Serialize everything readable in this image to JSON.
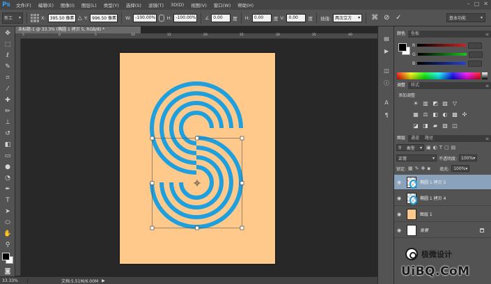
{
  "app": {
    "logo": "Ps"
  },
  "menu": [
    "文件(F)",
    "编辑(E)",
    "图像(I)",
    "图层(L)",
    "类型(Y)",
    "选择(S)",
    "滤镜(T)",
    "3D(D)",
    "视图(V)",
    "窗口(W)",
    "帮助(H)"
  ],
  "window_controls": {
    "minimize": "–",
    "maximize": "□",
    "close": "✕"
  },
  "options": {
    "tool_preset": "新工",
    "x_label": "X:",
    "x_value": "395.50 像素",
    "y_label": "Y:",
    "y_value": "996.50 像素",
    "w_label": "W:",
    "w_value": "-100.00%",
    "h_label": "H:",
    "h_value": "-100.00%",
    "angle_value": "0.00",
    "degree_unit": "度",
    "hskew_label": "H:",
    "hskew_value": "0.00",
    "vskew_label": "V:",
    "vskew_value": "0.00",
    "interp_label": "插值:",
    "interp_value": "两次立方",
    "workspace": "基本功能"
  },
  "document": {
    "tab_title": "未标题-1 @ 33.3% (椭圆 1 拷贝 5, RGB/8) *",
    "canvas_color": "#fec98a",
    "ring_color": "#1ea0de",
    "ruler_ticks": [
      "5",
      "0",
      "5",
      "10",
      "15",
      "20",
      "25",
      "30",
      "35",
      "40"
    ]
  },
  "status": {
    "zoom": "33.33%",
    "doc_size": "文档:5.51M/6.00M"
  },
  "color_panel": {
    "tabs": [
      "颜色",
      "色板"
    ],
    "channels": [
      {
        "label": "R",
        "color": "#d42020"
      },
      {
        "label": "G",
        "color": "#20c020"
      },
      {
        "label": "B",
        "color": "#2040e0"
      }
    ]
  },
  "adjust_panel": {
    "tabs": [
      "调整",
      "样式"
    ],
    "title": "添加调整",
    "row1": [
      "☀",
      "▥",
      "◩",
      "▨",
      "▽"
    ],
    "row2": [
      "▦",
      "⚖",
      "◧",
      "◐",
      "▩",
      "✣"
    ],
    "row3": [
      "◪",
      "◨",
      "▰",
      "▧",
      "◫"
    ]
  },
  "layers_panel": {
    "tabs": [
      "图层",
      "通道",
      "路径"
    ],
    "kind_filter": "类型",
    "blend_mode": "正常",
    "opacity_label": "不透明度:",
    "opacity_value": "100%",
    "lock_label": "锁定:",
    "fill_label": "填充:",
    "fill_value": "100%",
    "layers": [
      {
        "name": "椭圆 1 拷贝 5",
        "selected": true,
        "thumb": "shape"
      },
      {
        "name": "椭圆 1 拷贝 4",
        "selected": false,
        "thumb": "shape"
      },
      {
        "name": "图层 1",
        "selected": false,
        "thumb": "#fec98a"
      },
      {
        "name": "背景",
        "selected": false,
        "thumb": "#ffffff",
        "locked": true
      }
    ]
  },
  "watermark": {
    "text": "极微设计",
    "url": "UiBQ.CoM"
  }
}
